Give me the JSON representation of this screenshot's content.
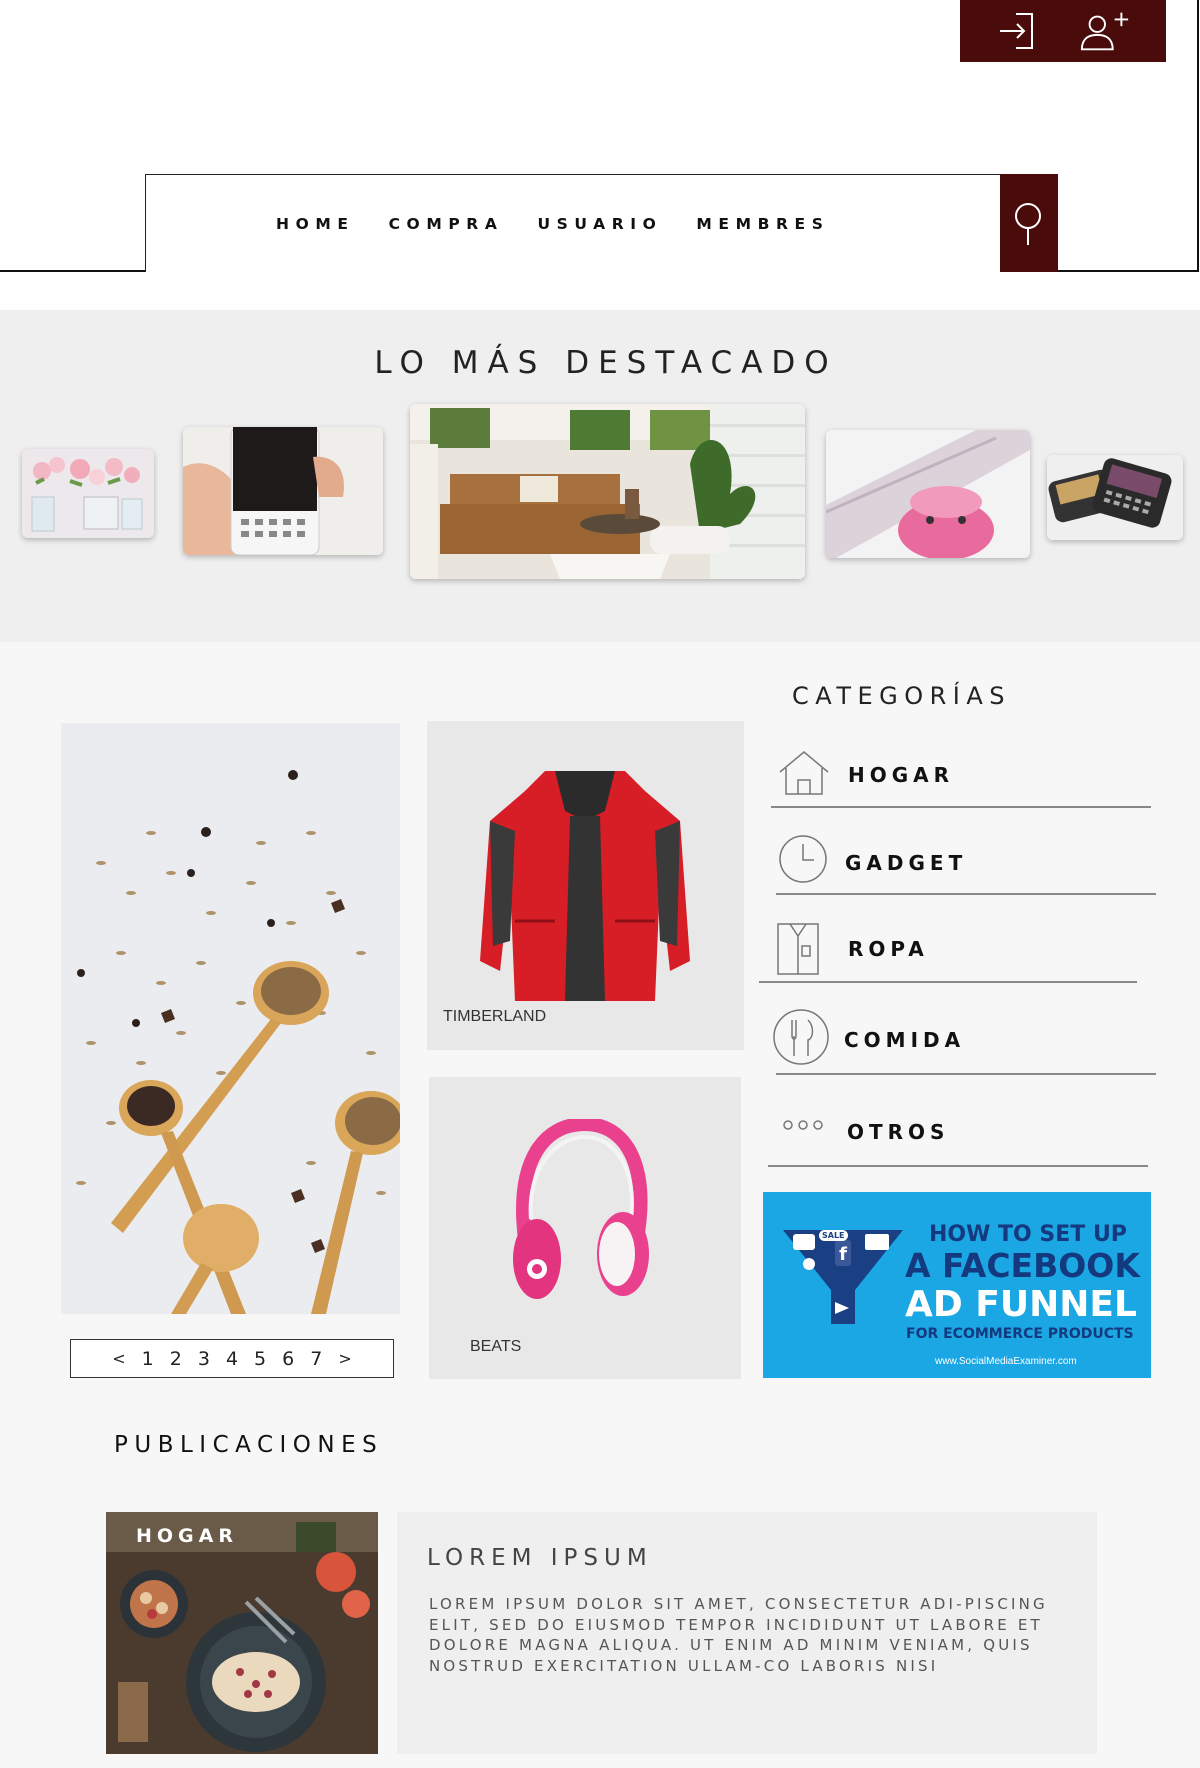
{
  "header": {
    "nav": [
      "HOME",
      "COMPRA",
      "USUARIO",
      "MEMBRES"
    ],
    "icons": {
      "login": "login-icon",
      "register": "add-user-icon",
      "search": "search-icon"
    },
    "accent_color": "#4a0b0b"
  },
  "featured": {
    "title": "LO MÁS DESTACADO",
    "slides": [
      "flowers-vase",
      "phone-keyboard",
      "living-room",
      "pink-speaker",
      "blackberry-phones"
    ]
  },
  "products": [
    {
      "label": "TIMBERLAND"
    },
    {
      "label": "BEATS"
    }
  ],
  "pagination": {
    "prev": "<",
    "pages": [
      "1",
      "2",
      "3",
      "4",
      "5",
      "6",
      "7"
    ],
    "next": ">"
  },
  "categories": {
    "title": "CATEGORÍAS",
    "items": [
      {
        "label": "HOGAR",
        "icon": "house-icon"
      },
      {
        "label": "GADGET",
        "icon": "clock-icon"
      },
      {
        "label": "ROPA",
        "icon": "shirt-icon"
      },
      {
        "label": "COMIDA",
        "icon": "cutlery-icon"
      },
      {
        "label": "OTROS",
        "icon": "more-dots-icon"
      }
    ]
  },
  "ad": {
    "line1": "HOW TO SET UP",
    "line2": "A FACEBOOK",
    "line3": "AD FUNNEL",
    "line4": "FOR ECOMMERCE PRODUCTS",
    "url": "www.SocialMediaExaminer.com",
    "badge": "SALE"
  },
  "publications": {
    "title": "PUBLICACIONES",
    "post": {
      "tag": "HOGAR",
      "title": "LOREM IPSUM",
      "body": "LOREM IPSUM DOLOR SIT AMET, CONSECTETUR ADI-PISCING ELIT, SED DO EIUSMOD TEMPOR INCIDIDUNT UT LABORE ET DOLORE MAGNA ALIQUA. UT ENIM AD MINIM VENIAM, QUIS NOSTRUD EXERCITATION ULLAM-CO LABORIS NISI"
    }
  }
}
